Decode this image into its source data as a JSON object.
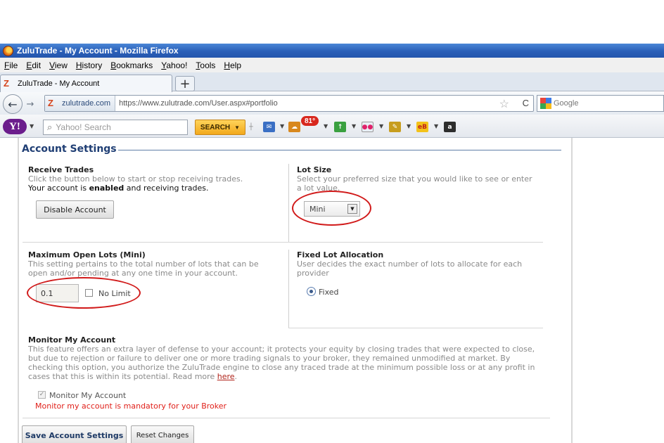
{
  "window": {
    "title": "ZuluTrade - My Account - Mozilla Firefox"
  },
  "menu": [
    "File",
    "Edit",
    "View",
    "History",
    "Bookmarks",
    "Yahoo!",
    "Tools",
    "Help"
  ],
  "tab": {
    "label": "ZuluTrade - My Account",
    "new_tab": "+"
  },
  "nav": {
    "back": "←",
    "forward": "→",
    "identity": "zulutrade.com",
    "url": "https://www.zulutrade.com/User.aspx#portfolio",
    "star": "☆",
    "reload": "C",
    "search_placeholder": "Google"
  },
  "yahoo": {
    "logo": "Y!",
    "search_placeholder": "Yahoo! Search",
    "search_button": "SEARCH",
    "badge": "81°"
  },
  "settings": {
    "title": "Account Settings",
    "receive": {
      "header": "Receive Trades",
      "desc_line1": "Click the button below to start or stop receiving trades.",
      "status_prefix": "Your account is",
      "status_bold": "enabled",
      "status_suffix": "and receiving trades.",
      "button": "Disable Account"
    },
    "lot_size": {
      "header": "Lot Size",
      "desc_line1": "Select your preferred size that you would like to see or enter",
      "desc_line2": "a lot value.",
      "selected": "Mini",
      "arrow": "▼"
    },
    "max_lots": {
      "header": "Maximum Open Lots (Mini)",
      "desc_line1": "This setting pertains to the total number of lots that can be",
      "desc_line2": "open and/or pending at any one time in your account.",
      "value": "0.1",
      "no_limit_label": "No Limit"
    },
    "fixed_lot": {
      "header": "Fixed Lot Allocation",
      "desc_line1": "User decides the exact number of lots to allocate for each",
      "desc_line2": "provider",
      "option": "Fixed"
    },
    "monitor": {
      "header": "Monitor My Account",
      "desc_line1": "This feature offers an extra layer of defense to your account; it protects your equity by closing trades that were expected to close,",
      "desc_line2": "but due to rejection or failure to deliver one or more trading signals to your broker, they remained unmodified at market. By",
      "desc_line3": "checking this option, you authorize the ZuluTrade engine to close any traced trade at the minimum possible loss or at any profit in",
      "desc_line4_prefix": "cases that this is within its potential. Read more",
      "link": "here",
      "desc_line4_suffix": ".",
      "checkbox_label": "Monitor My Account",
      "warning": "Monitor my account is mandatory for your Broker"
    },
    "save_button": "Save Account Settings",
    "reset_button": "Reset Changes"
  },
  "colors": {
    "section_title": "#1f3e74",
    "warning": "#e0201a",
    "annotation": "#d11a1a"
  }
}
